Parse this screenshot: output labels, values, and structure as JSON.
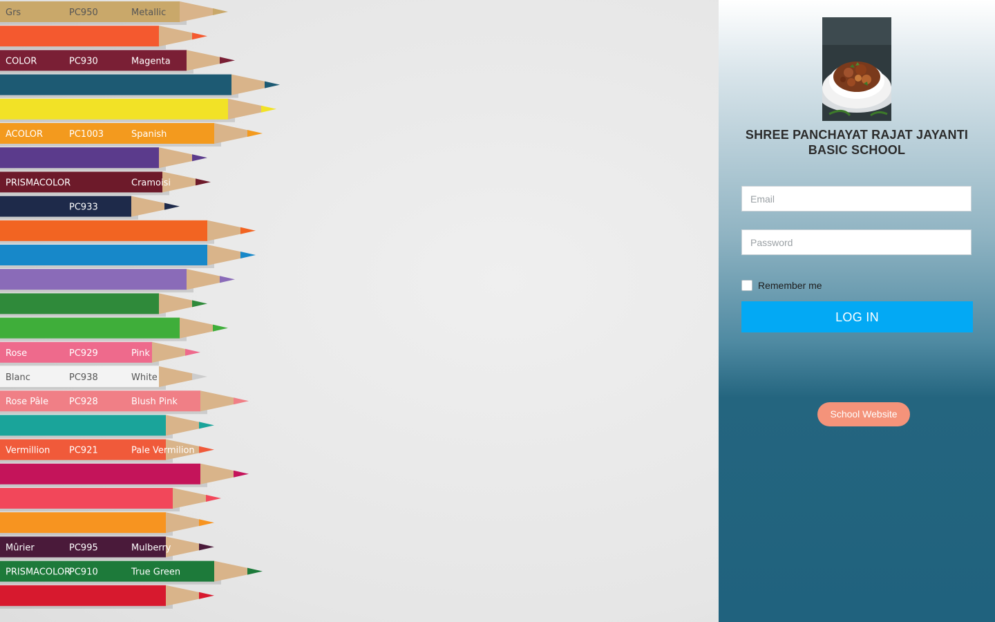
{
  "panel": {
    "school_name": "SHREE PANCHAYAT RAJAT JAYANTI BASIC SCHOOL",
    "email_placeholder": "Email",
    "password_placeholder": "Password",
    "remember_label": "Remember me",
    "login_label": "LOG IN",
    "website_label": "School Website"
  },
  "colors": {
    "login_button": "#03a9f4",
    "website_button": "#f4937a",
    "panel_bottom": "#20627e"
  },
  "pencil_labels": [
    {
      "brand": "Grs",
      "code": "PC950",
      "color": "Metallic"
    },
    {
      "brand": "",
      "code": "",
      "color": ""
    },
    {
      "brand": "COLOR",
      "code": "PC930",
      "color": "Magenta"
    },
    {
      "brand": "",
      "code": "",
      "color": ""
    },
    {
      "brand": "",
      "code": "",
      "color": ""
    },
    {
      "brand": "ACOLOR",
      "code": "PC1003",
      "color": "Spanish"
    },
    {
      "brand": "",
      "code": "",
      "color": ""
    },
    {
      "brand": "PRISMACOLOR",
      "code": "",
      "color": "Cramoisi"
    },
    {
      "brand": "",
      "code": "PC933",
      "color": ""
    },
    {
      "brand": "",
      "code": "",
      "color": ""
    },
    {
      "brand": "",
      "code": "",
      "color": ""
    },
    {
      "brand": "",
      "code": "",
      "color": ""
    },
    {
      "brand": "",
      "code": "",
      "color": ""
    },
    {
      "brand": "",
      "code": "",
      "color": ""
    },
    {
      "brand": "Rose",
      "code": "PC929",
      "color": "Pink"
    },
    {
      "brand": "Blanc",
      "code": "PC938",
      "color": "White"
    },
    {
      "brand": "Rose Pâle",
      "code": "PC928",
      "color": "Blush Pink"
    },
    {
      "brand": "",
      "code": "",
      "color": ""
    },
    {
      "brand": "Vermillion",
      "code": "PC921",
      "color": "Pale Vermilion"
    },
    {
      "brand": "",
      "code": "",
      "color": ""
    },
    {
      "brand": "",
      "code": "",
      "color": ""
    },
    {
      "brand": "",
      "code": "",
      "color": ""
    },
    {
      "brand": "Mûrier",
      "code": "PC995",
      "color": "Mulberry"
    },
    {
      "brand": "PRISMACOLOR",
      "code": "PC910",
      "color": "True Green"
    },
    {
      "brand": "",
      "code": "",
      "color": ""
    }
  ]
}
